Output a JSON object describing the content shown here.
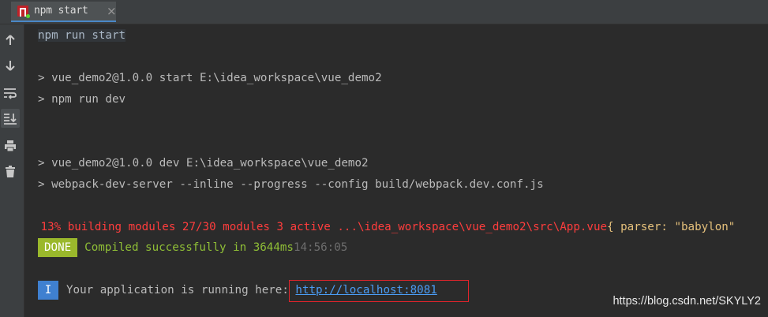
{
  "tab": {
    "label": "npm start",
    "close": "×",
    "icon": "npm-icon",
    "status_icon": "running-dot-icon"
  },
  "toolbar": {
    "icons": [
      "arrow-up-icon",
      "arrow-down-icon",
      "soft-wrap-icon",
      "scroll-to-end-icon",
      "print-icon",
      "trash-icon"
    ]
  },
  "console": {
    "cmd": "npm run start",
    "prompt": ">",
    "line1": "vue_demo2@1.0.0 start E:\\idea_workspace\\vue_demo2",
    "line2": "npm run dev",
    "line3": "vue_demo2@1.0.0 dev E:\\idea_workspace\\vue_demo2",
    "line4": "webpack-dev-server --inline --progress --config build/webpack.dev.conf.js",
    "progress_red": " 13% building modules 27/30 modules 3 active ...\\idea_workspace\\vue_demo2\\src\\App.vue",
    "progress_yellow": "{ parser: \"babylon\"",
    "done_badge": "DONE",
    "compiled": "Compiled successfully in 3644ms",
    "time": "14:56:05",
    "info_badge": "I",
    "running_text": "Your application is running here: ",
    "url": "http://localhost:8081"
  },
  "watermark": "https://blog.csdn.net/SKYLY2",
  "colors": {
    "background": "#2b2b2b",
    "red": "#ff3d3d",
    "yellow": "#e5c07b",
    "green": "#8fbe36",
    "link": "#4a9cf5",
    "done_badge": "#9ab82c",
    "info_badge": "#3f80d0"
  }
}
